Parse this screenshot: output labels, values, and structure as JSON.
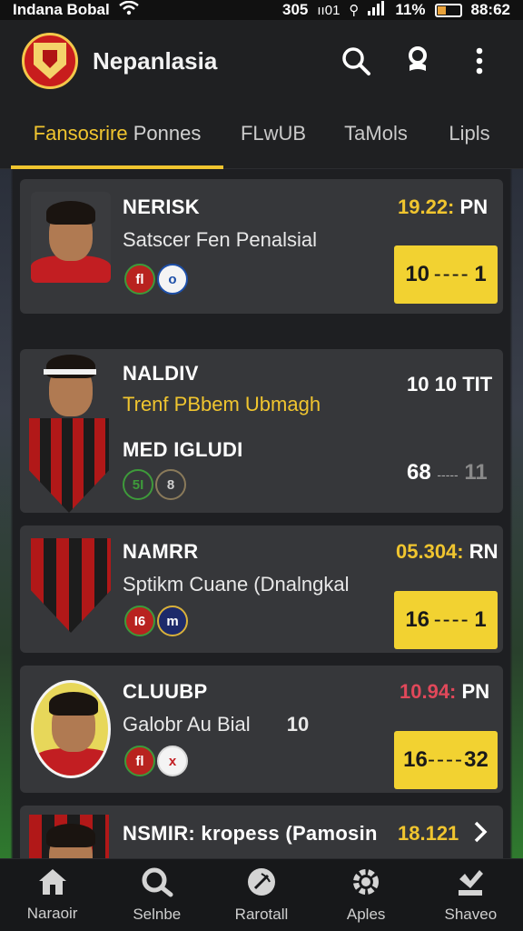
{
  "status_bar": {
    "carrier": "Indana Bobal",
    "center_text": "305",
    "signal_text": "ıı01",
    "battery_percent": "11%",
    "time": "88:62"
  },
  "header": {
    "title": "Nepanlasia",
    "icons": [
      "search-icon",
      "notification-icon",
      "more-vert-icon"
    ]
  },
  "tabs": [
    {
      "label": "Fansosrire",
      "sub": "Ponnes",
      "active": true
    },
    {
      "label": "FLwUB",
      "active": false
    },
    {
      "label": "TaMols",
      "active": false
    },
    {
      "label": "Lipls",
      "active": false
    }
  ],
  "matches": [
    {
      "name": "NERISK",
      "description": "Satscer Fen Penalsial",
      "time": "19.22:",
      "time_suffix": "PN",
      "time_color": "#f0c52f",
      "score_home": "10",
      "score_away": "1",
      "score_style": "box",
      "badges": [
        "fl",
        "o"
      ]
    },
    {
      "name": "NALDIV",
      "description": "Trenf PBbem Ubmagh",
      "name2": "MED IGLUDI",
      "time": "10 10",
      "time_suffix": "TIT",
      "time_color": "#ffffff",
      "score_home": "68",
      "score_away": "11",
      "score_style": "plain",
      "badges": [
        "5I",
        "8"
      ]
    },
    {
      "name": "NAMRR",
      "description": "Sptikm Cuane (Dnalngkal",
      "time": "05.304:",
      "time_suffix": "RN",
      "time_color": "#f0c52f",
      "score_home": "16",
      "score_away": "1",
      "score_style": "box",
      "badges": [
        "I6",
        "m"
      ]
    },
    {
      "name": "CLUUBP",
      "description": "Galobr Au Bial",
      "extra": "10",
      "time": "10.94:",
      "time_suffix": "PN",
      "time_color": "#e0485a",
      "score_home": "16",
      "score_away": "32",
      "score_style": "box",
      "badges": [
        "fl",
        "x"
      ]
    },
    {
      "name": "NSMIR: kropess (Pamosin",
      "time": "18.121",
      "time_color": "#f0c52f"
    }
  ],
  "bottom_nav": [
    {
      "label": "Naraoir",
      "icon": "home-icon"
    },
    {
      "label": "Selnbe",
      "icon": "search-icon"
    },
    {
      "label": "Rarotall",
      "icon": "football-icon"
    },
    {
      "label": "Aples",
      "icon": "gear-icon"
    },
    {
      "label": "Shaveo",
      "icon": "saved-icon"
    }
  ]
}
